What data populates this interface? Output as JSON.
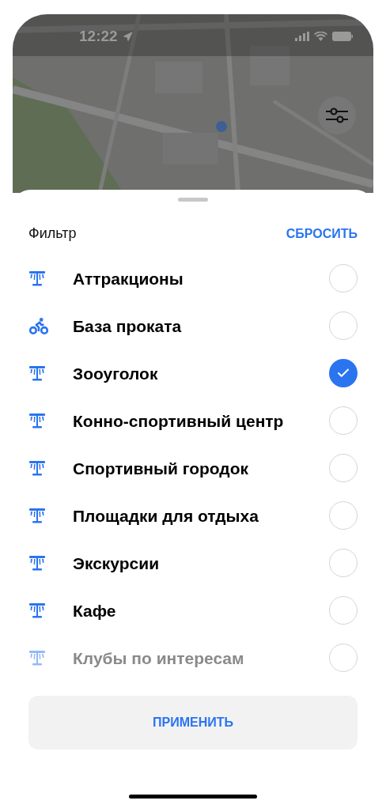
{
  "status_bar": {
    "time": "12:22"
  },
  "sheet": {
    "title": "Фильтр",
    "reset": "СБРОСИТЬ"
  },
  "items": [
    {
      "label": "Аттракционы",
      "kind": "carousel",
      "checked": false,
      "disabled": false
    },
    {
      "label": "База проката",
      "kind": "bike",
      "checked": false,
      "disabled": false
    },
    {
      "label": "Зооуголок",
      "kind": "carousel",
      "checked": true,
      "disabled": false
    },
    {
      "label": "Конно-спортивный центр",
      "kind": "carousel",
      "checked": false,
      "disabled": false
    },
    {
      "label": "Спортивный городок",
      "kind": "carousel",
      "checked": false,
      "disabled": false
    },
    {
      "label": "Площадки для отдыха",
      "kind": "carousel",
      "checked": false,
      "disabled": false
    },
    {
      "label": "Экскурсии",
      "kind": "carousel",
      "checked": false,
      "disabled": false
    },
    {
      "label": "Кафе",
      "kind": "carousel",
      "checked": false,
      "disabled": false
    },
    {
      "label": "Клубы по интересам",
      "kind": "carousel",
      "checked": false,
      "disabled": true
    }
  ],
  "apply_button": "ПРИМЕНИТЬ"
}
